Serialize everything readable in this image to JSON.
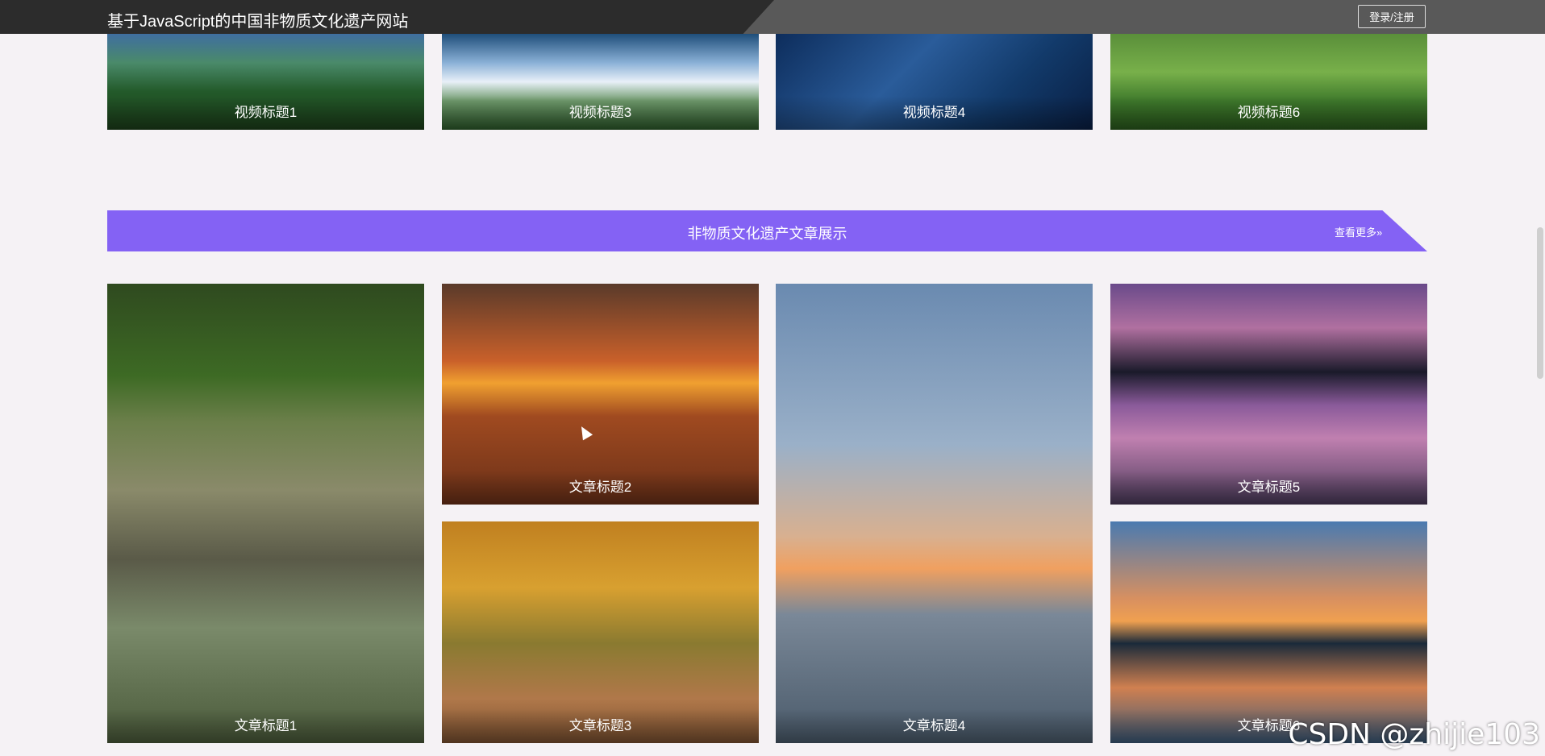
{
  "header": {
    "title": "基于JavaScript的中国非物质文化遗产网站",
    "login_label": "登录/注册"
  },
  "videos": [
    {
      "title": "视频标题1"
    },
    {
      "title": "视频标题3"
    },
    {
      "title": "视频标题4"
    },
    {
      "title": "视频标题6"
    }
  ],
  "articles_section": {
    "title": "非物质文化遗产文章展示",
    "more_label": "查看更多»"
  },
  "articles": [
    {
      "title": "文章标题1"
    },
    {
      "title": "文章标题2"
    },
    {
      "title": "文章标题3"
    },
    {
      "title": "文章标题4"
    },
    {
      "title": "文章标题5"
    },
    {
      "title": "文章标题6"
    }
  ],
  "watermark": "CSDN @zhijie103"
}
